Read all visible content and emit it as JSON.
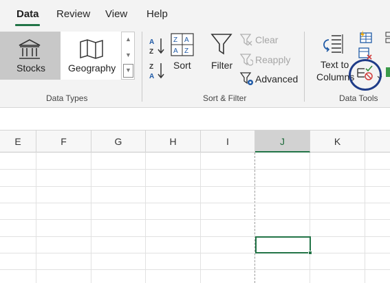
{
  "menu": {
    "tabs": [
      "Data",
      "Review",
      "View",
      "Help"
    ],
    "active": "Data"
  },
  "ribbon": {
    "data_types": {
      "stocks_label": "Stocks",
      "geography_label": "Geography",
      "group_label": "Data Types"
    },
    "sort_filter": {
      "sort_label": "Sort",
      "filter_label": "Filter",
      "clear_label": "Clear",
      "reapply_label": "Reapply",
      "advanced_label": "Advanced",
      "group_label": "Sort & Filter"
    },
    "data_tools": {
      "text_to_columns_line1": "Text to",
      "text_to_columns_line2": "Columns",
      "group_label": "Data Tools"
    }
  },
  "sheet": {
    "columns": [
      "E",
      "F",
      "G",
      "H",
      "I",
      "J",
      "K"
    ],
    "selected_column": "J"
  },
  "colors": {
    "accent": "#217346",
    "highlight_ring": "#1f3c88"
  }
}
